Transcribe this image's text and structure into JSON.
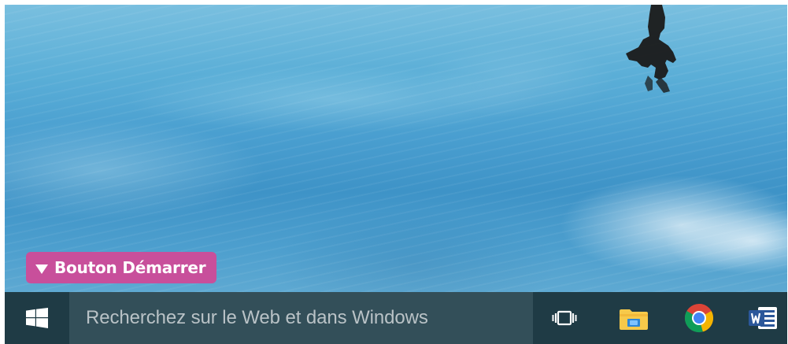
{
  "colors": {
    "callout_bg": "#c84f9b",
    "taskbar_bg": "#1f3b45",
    "search_bg": "#334f59",
    "search_text": "#b9c2c6"
  },
  "callout": {
    "label": "Bouton Démarrer",
    "icon": "triangle-down-icon"
  },
  "taskbar": {
    "start_icon": "windows-logo-icon",
    "search": {
      "placeholder": "Recherchez sur le Web et dans Windows"
    },
    "icons": [
      {
        "name": "task-view-icon"
      },
      {
        "name": "file-explorer-icon"
      },
      {
        "name": "chrome-icon"
      },
      {
        "name": "word-icon"
      }
    ]
  }
}
